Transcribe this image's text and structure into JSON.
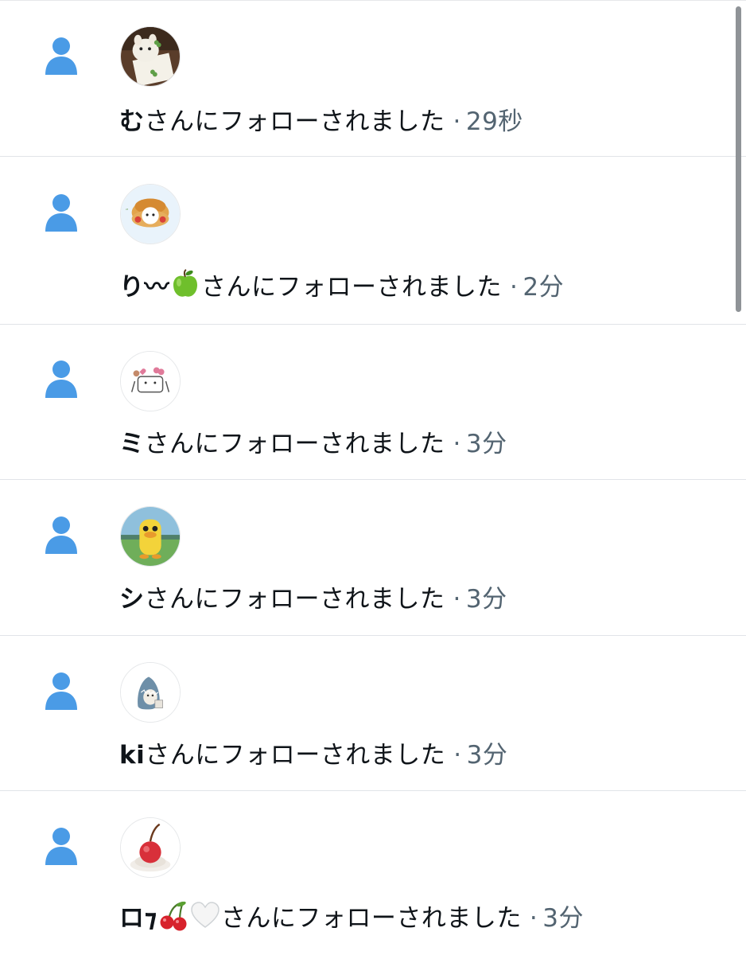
{
  "notifications": [
    {
      "user": "む",
      "suffix": "さんにフォローされました",
      "sep": "·",
      "time": "29秒",
      "avatar": "cat-with-clover-photo"
    },
    {
      "user": "り〰",
      "emoji": [
        "green-apple"
      ],
      "suffix": "さんにフォローされました",
      "sep": "·",
      "time": "2分",
      "avatar": "cat-in-cream-puff"
    },
    {
      "user": "ミ",
      "suffix": "さんにフォローされました",
      "sep": "·",
      "time": "3分",
      "avatar": "cat-with-hearts-sketch"
    },
    {
      "user": "シ",
      "suffix": "さんにフォローされました",
      "sep": "·",
      "time": "3分",
      "avatar": "yellow-duck-character"
    },
    {
      "user": "ki",
      "suffix": "さんにフォローされました",
      "sep": "·",
      "time": "3分",
      "avatar": "shark-hood-cat"
    },
    {
      "user": "ロ⁊",
      "emoji": [
        "cherries",
        "white-heart"
      ],
      "suffix": "さんにフォローされました",
      "sep": "·",
      "time": "3分",
      "avatar": "cherry-jelly"
    }
  ],
  "colors": {
    "accent": "#4a9be6",
    "muted": "#536471",
    "divider": "#e1e4e8"
  },
  "icons": {
    "row_icon": "person-follow-icon"
  }
}
